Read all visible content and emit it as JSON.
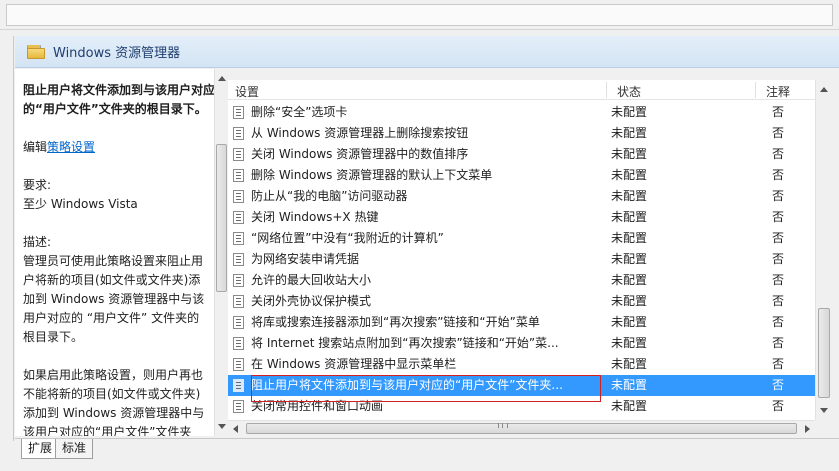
{
  "header": {
    "title": "Windows 资源管理器"
  },
  "description": {
    "title": "阻止用户将文件添加到与该用户对应的“用户文件”文件夹的根目录下。",
    "edit_prefix": "编辑",
    "edit_link": "策略设置",
    "requirement_label": "要求:",
    "requirement_value": "至少 Windows Vista",
    "desc_label": "描述:",
    "desc_text": "管理员可使用此策略设置来阻止用户将新的项目(如文件或文件夹)添加到 Windows 资源管理器中与该用户对应的 “用户文件” 文件夹的根目录下。",
    "desc_text2": "如果启用此策略设置，则用户再也不能将新的项目(如文件或文件夹)添加到 Windows 资源管理器中与该用户对应的“用户文件”文件夹"
  },
  "list": {
    "columns": {
      "settings": "设置",
      "status": "状态",
      "note": "注释"
    },
    "rows": [
      {
        "name": "删除“安全”选项卡",
        "status": "未配置",
        "note": "否"
      },
      {
        "name": "从 Windows 资源管理器上删除搜索按钮",
        "status": "未配置",
        "note": "否"
      },
      {
        "name": "关闭 Windows 资源管理器中的数值排序",
        "status": "未配置",
        "note": "否"
      },
      {
        "name": "删除 Windows 资源管理器的默认上下文菜单",
        "status": "未配置",
        "note": "否"
      },
      {
        "name": "防止从“我的电脑”访问驱动器",
        "status": "未配置",
        "note": "否"
      },
      {
        "name": "关闭 Windows+X 热键",
        "status": "未配置",
        "note": "否"
      },
      {
        "name": "“网络位置”中没有“我附近的计算机”",
        "status": "未配置",
        "note": "否"
      },
      {
        "name": "为网络安装申请凭据",
        "status": "未配置",
        "note": "否"
      },
      {
        "name": "允许的最大回收站大小",
        "status": "未配置",
        "note": "否"
      },
      {
        "name": "关闭外壳协议保护模式",
        "status": "未配置",
        "note": "否"
      },
      {
        "name": "将库或搜索连接器添加到“再次搜索”链接和“开始”菜单",
        "status": "未配置",
        "note": "否"
      },
      {
        "name": "将 Internet 搜索站点附加到“再次搜索”链接和“开始”菜...",
        "status": "未配置",
        "note": "否"
      },
      {
        "name": "在 Windows 资源管理器中显示菜单栏",
        "status": "未配置",
        "note": "否"
      },
      {
        "name": "阻止用户将文件添加到与该用户对应的“用户文件”文件夹...",
        "status": "未配置",
        "note": "否"
      },
      {
        "name": "关闭常用控件和窗口动画",
        "status": "未配置",
        "note": "否"
      }
    ]
  },
  "tabs": {
    "extend": "扩展",
    "standard": "标准"
  },
  "colors": {
    "selection": "#3399ff",
    "highlight_border": "#d32020",
    "header_bg": "#dbe8f6"
  }
}
